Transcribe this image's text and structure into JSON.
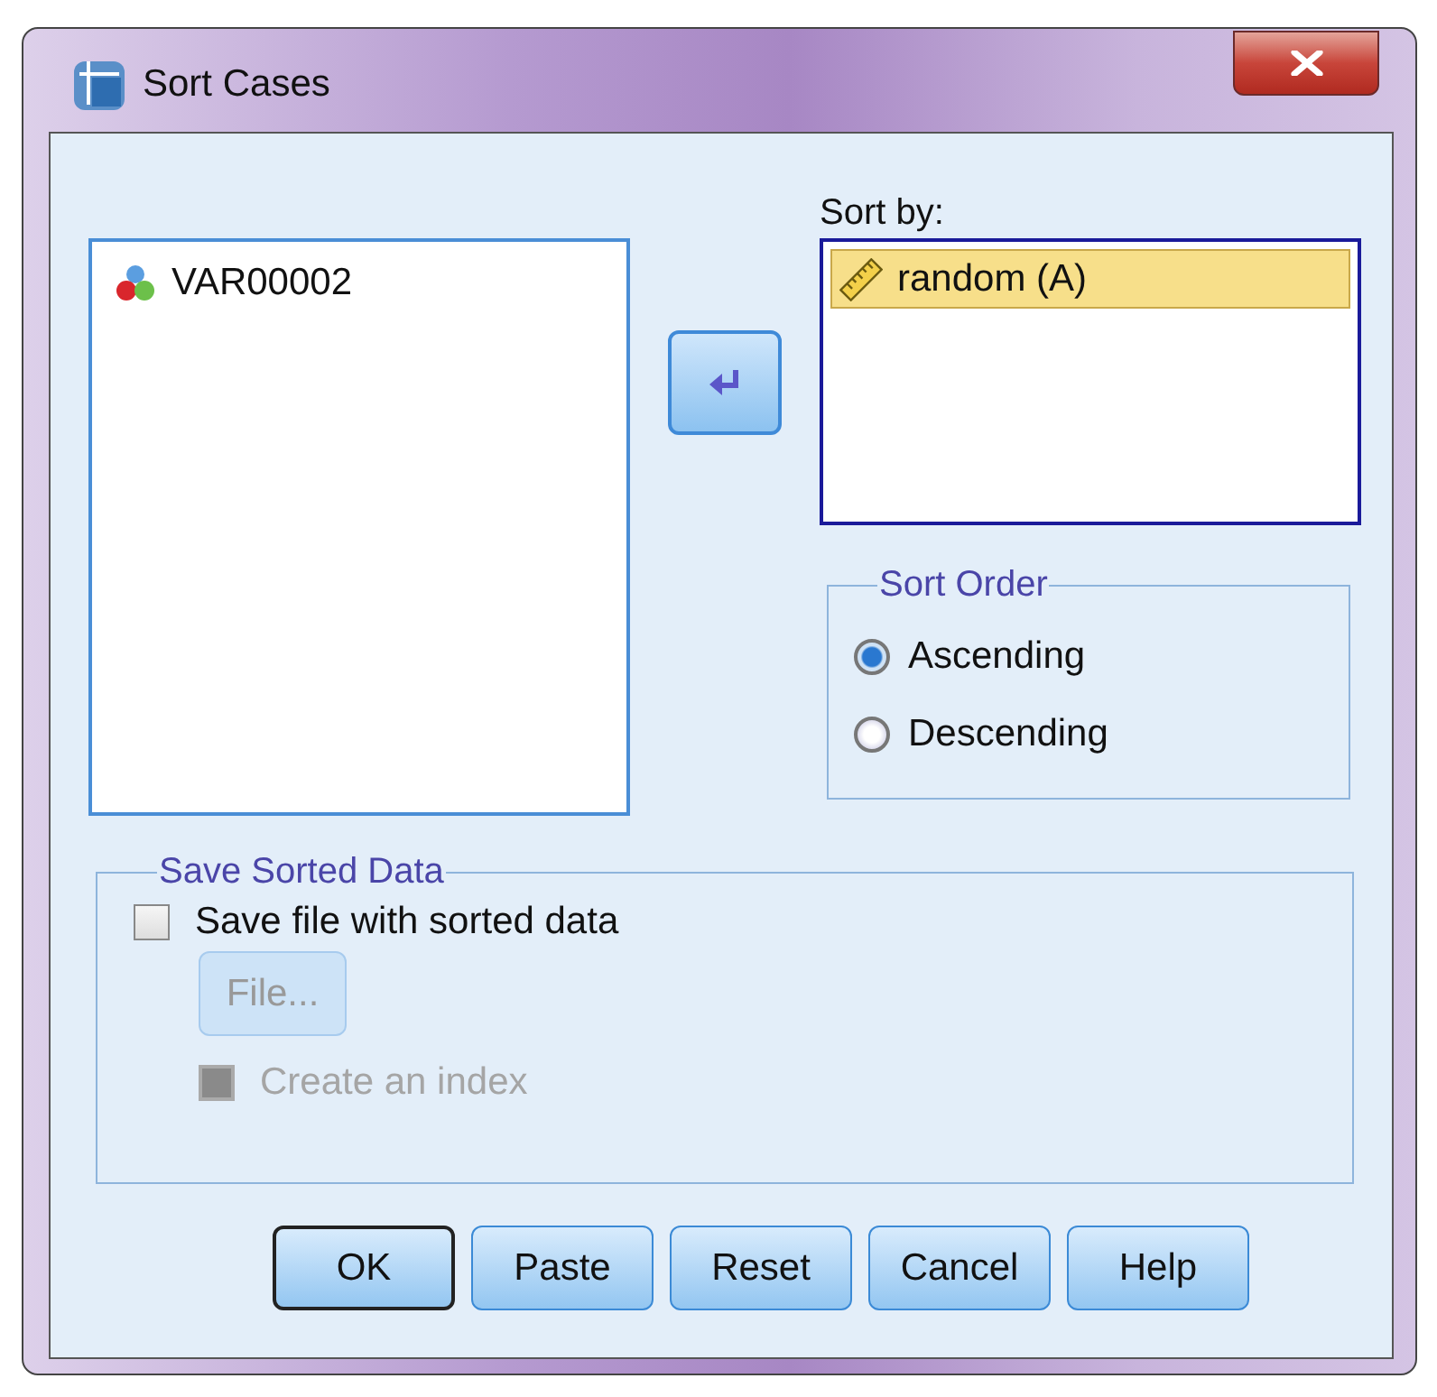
{
  "window": {
    "title": "Sort Cases"
  },
  "variables": {
    "items": [
      {
        "label": "VAR00002",
        "kind": "nominal",
        "selected": false
      }
    ]
  },
  "sort_by": {
    "label": "Sort by:",
    "items": [
      {
        "label": "random (A)",
        "kind": "scale",
        "selected": true
      }
    ]
  },
  "sort_order": {
    "title": "Sort Order",
    "options": [
      {
        "label": "Ascending",
        "selected": true
      },
      {
        "label": "Descending",
        "selected": false
      }
    ]
  },
  "save_sorted_data": {
    "title": "Save Sorted Data",
    "save_checkbox": {
      "label": "Save file with sorted data",
      "checked": false,
      "disabled": false
    },
    "file_button": {
      "label": "File...",
      "disabled": true
    },
    "index_checkbox": {
      "label": "Create an index",
      "checked": false,
      "disabled": true
    }
  },
  "buttons": [
    {
      "label": "OK",
      "default": true
    },
    {
      "label": "Paste",
      "default": false
    },
    {
      "label": "Reset",
      "default": false
    },
    {
      "label": "Cancel",
      "default": false
    },
    {
      "label": "Help",
      "default": false
    }
  ]
}
